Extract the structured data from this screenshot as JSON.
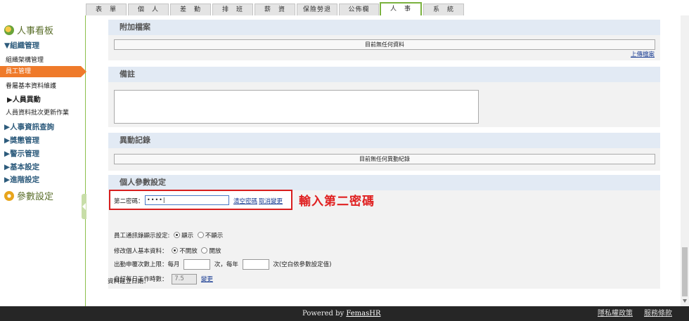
{
  "top_tabs": [
    "表　單",
    "個　人",
    "差　勤",
    "排　班",
    "薪　資",
    "保險勞退",
    "公佈欄",
    "人　事",
    "系　統"
  ],
  "active_tab": "人　事",
  "sidebar": {
    "board_title": "人事看板",
    "group_org": "▼組織管理",
    "item_org_chart": "組織架構管理",
    "item_employee_mgmt": "員工管理",
    "item_subordinate_basic": "眷屬基本資料維護",
    "sub_personnel_change": "▶人員異動",
    "item_batch_update": "人員資料批次更新作業",
    "group_hr_query": "▶人事資訊查詢",
    "group_reward": "▶獎懲管理",
    "group_warning": "▶警示管理",
    "group_basic_settings": "▶基本設定",
    "group_advanced": "▶進階設定",
    "params_title": "參數設定"
  },
  "attachments": {
    "title": "附加檔案",
    "empty": "目前無任何資料",
    "upload_link": "上傳檔案"
  },
  "notes": {
    "title": "備註"
  },
  "changes": {
    "title": "異動記錄",
    "empty": "目前無任何異動紀錄"
  },
  "personal": {
    "title": "個人參數設定",
    "second_pw_label": "第二密碼：",
    "second_pw_value": "••••|",
    "clear_pw": "清空密碼",
    "cancel_change": "取消變更",
    "annotation": "輸入第二密碼",
    "contacts_label": "員工通訊錄顯示設定:",
    "show": "顯示",
    "hide": "不顯示",
    "edit_basic_label": "修改個人基本資料：",
    "not_open": "不開放",
    "open": "開放",
    "attend_label": "出勤申覆次數上限：每月",
    "times_per_year": "次，每年",
    "times_note": "次(空白依參數設定值)",
    "daily_hours_label": "自訂每日工作時數：",
    "daily_hours_value": "7.5",
    "change_link": "變更"
  },
  "created_label": "資料建立日期：",
  "footer": {
    "powered_prefix": "Powered by ",
    "brand": "FemasHR",
    "privacy": "隱私權政策",
    "terms": "服務條款"
  }
}
